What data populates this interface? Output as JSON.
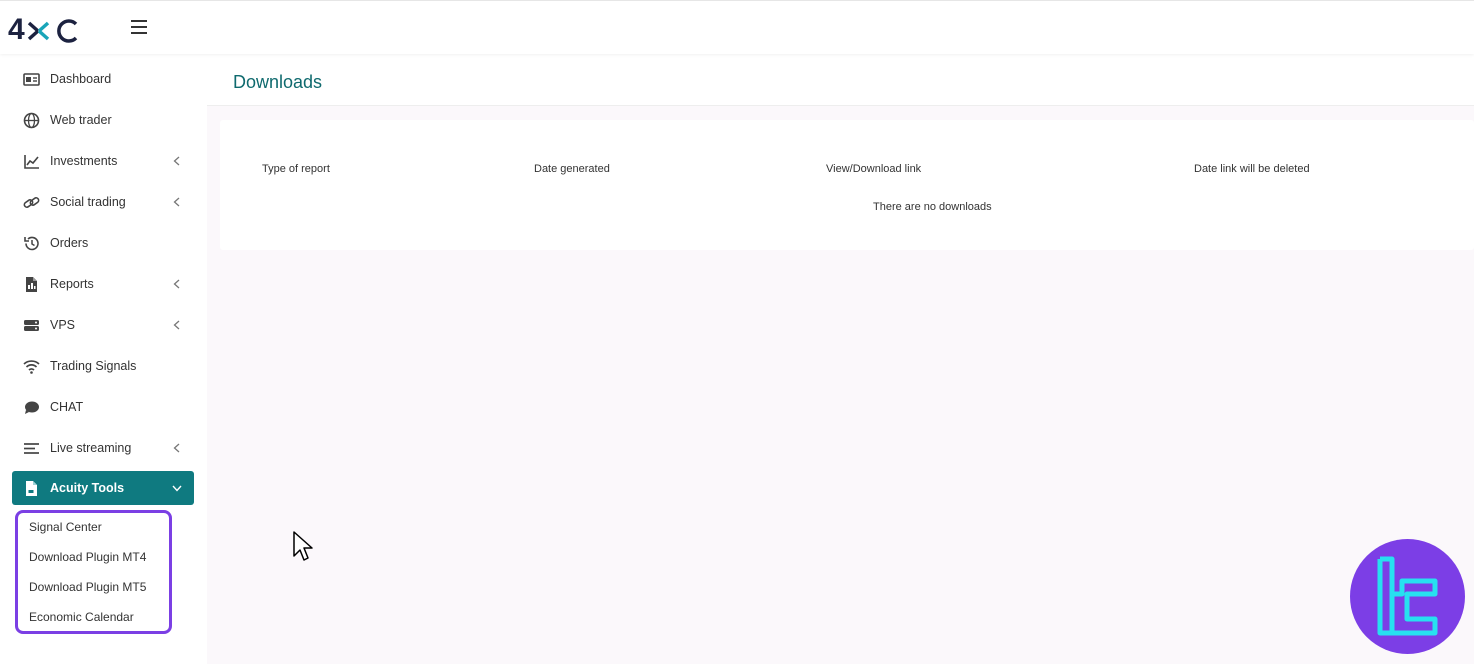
{
  "brand": {
    "logo_text": "4XC"
  },
  "sidebar": {
    "items": [
      {
        "label": "Dashboard",
        "icon": "dashboard-icon"
      },
      {
        "label": "Web trader",
        "icon": "globe-icon"
      },
      {
        "label": "Investments",
        "icon": "chart-line-icon",
        "expandable": true
      },
      {
        "label": "Social trading",
        "icon": "link-icon",
        "expandable": true
      },
      {
        "label": "Orders",
        "icon": "history-icon"
      },
      {
        "label": "Reports",
        "icon": "file-icon",
        "expandable": true
      },
      {
        "label": "VPS",
        "icon": "server-icon",
        "expandable": true
      },
      {
        "label": "Trading Signals",
        "icon": "wifi-icon"
      },
      {
        "label": "CHAT",
        "icon": "chat-icon"
      },
      {
        "label": "Live streaming",
        "icon": "list-icon",
        "expandable": true
      },
      {
        "label": "Acuity Tools",
        "icon": "document-icon",
        "expandable": true,
        "active": true
      }
    ],
    "submenu": [
      {
        "label": "Signal Center"
      },
      {
        "label": "Download Plugin MT4"
      },
      {
        "label": "Download Plugin MT5"
      },
      {
        "label": "Economic Calendar"
      }
    ]
  },
  "page": {
    "title": "Downloads"
  },
  "table": {
    "headers": [
      "Type of report",
      "Date generated",
      "View/Download link",
      "Date link will be deleted"
    ],
    "empty_message": "There are no downloads"
  },
  "colors": {
    "accent": "#0f7a80",
    "highlight": "#7b3fe4",
    "background": "#fbf8fb"
  }
}
